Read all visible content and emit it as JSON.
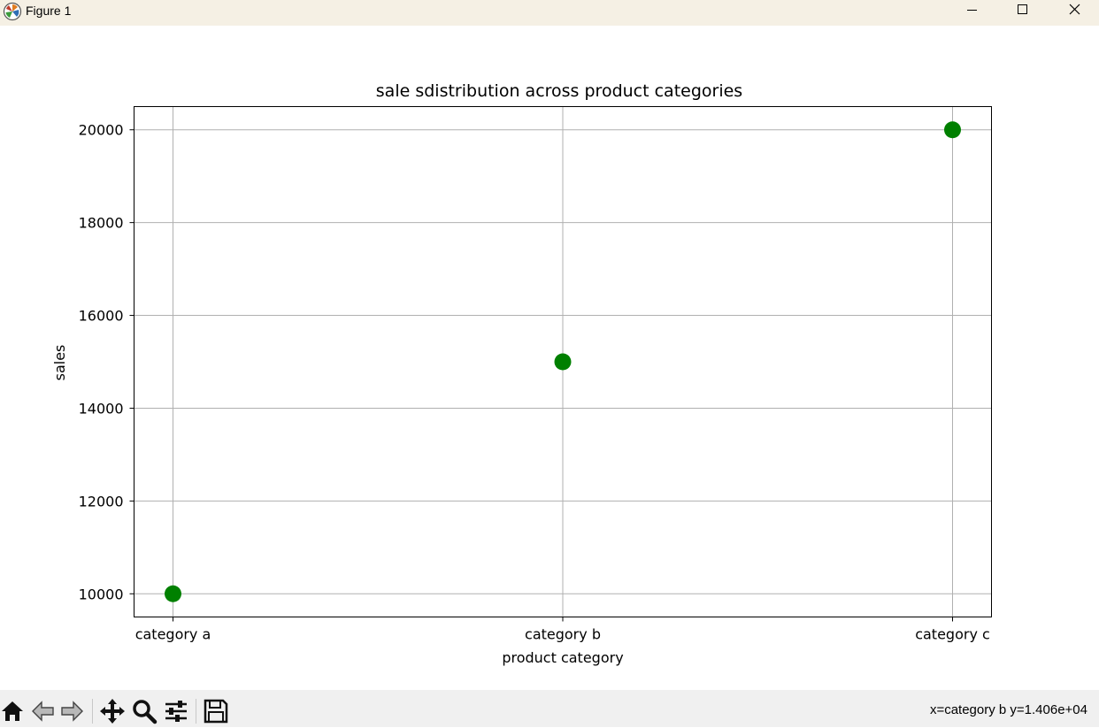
{
  "window": {
    "title": "Figure 1",
    "app_icon": "matplotlib-logo-icon",
    "controls": [
      "minimize-icon",
      "maximize-icon",
      "close-icon"
    ]
  },
  "toolbar": {
    "tools": [
      "home-icon",
      "back-arrow-icon",
      "forward-arrow-icon",
      "pan-icon",
      "zoom-magnifier-icon",
      "subplots-sliders-icon",
      "save-floppy-icon"
    ],
    "coordinates": "x=category b y=1.406e+04"
  },
  "colors": {
    "titlebar": "#f5f0e4",
    "toolbar": "#f0f0f0",
    "marker": "#008000",
    "grid": "#b0b0b0"
  },
  "chart_data": {
    "type": "scatter",
    "title": "sale sdistribution across product categories",
    "xlabel": "product category",
    "ylabel": "sales",
    "categories": [
      "category a",
      "category b",
      "category c"
    ],
    "values": [
      10000,
      15000,
      20000
    ],
    "ylim": [
      9500,
      20500
    ],
    "yticks": [
      10000,
      12000,
      14000,
      16000,
      18000,
      20000
    ],
    "grid": true,
    "marker_color": "#008000"
  }
}
